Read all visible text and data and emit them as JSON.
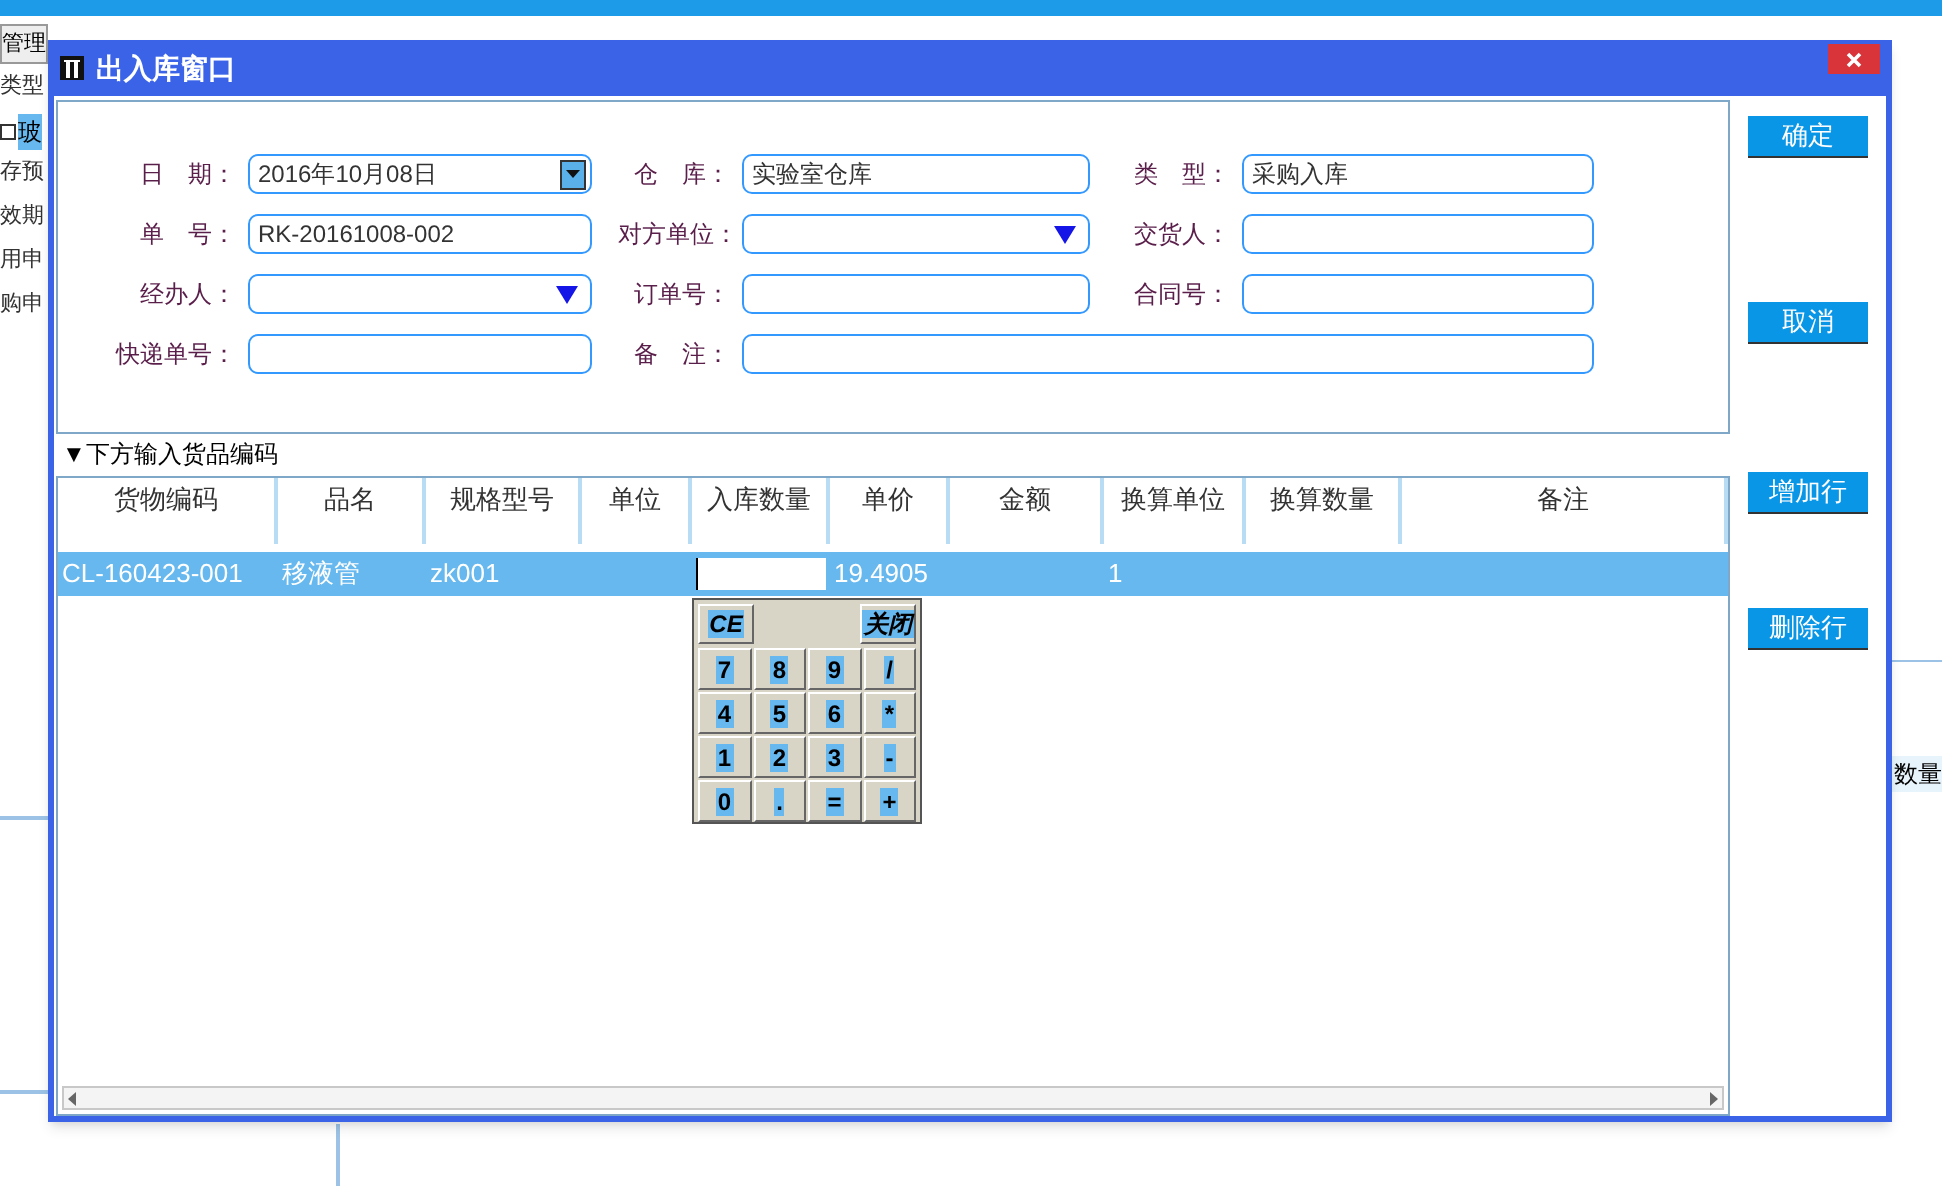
{
  "background": {
    "sidebar_items": [
      {
        "text": "管理",
        "kind": "button"
      },
      {
        "text": "类型",
        "kind": "text"
      },
      {
        "text": "玻",
        "kind": "checkbox",
        "checked": false,
        "selected": true
      },
      {
        "text": "存预",
        "kind": "text"
      },
      {
        "text": "效期",
        "kind": "text"
      },
      {
        "text": "用申",
        "kind": "text"
      },
      {
        "text": "购申",
        "kind": "text"
      }
    ],
    "column_label": "数量"
  },
  "dialog": {
    "title": "出入库窗口",
    "form": {
      "rows": [
        [
          {
            "label": "日　期：",
            "value": "2016年10月08日",
            "kind": "date"
          },
          {
            "label": "仓　库：",
            "value": "实验室仓库",
            "kind": "text"
          },
          {
            "label": "类　型：",
            "value": "采购入库",
            "kind": "text"
          }
        ],
        [
          {
            "label": "单　号：",
            "value": "RK-20161008-002",
            "kind": "text"
          },
          {
            "label": "对方单位：",
            "kind": "select"
          },
          {
            "label": "交货人：",
            "kind": "text"
          }
        ],
        [
          {
            "label": "经办人：",
            "kind": "select"
          },
          {
            "label": "订单号：",
            "kind": "text"
          },
          {
            "label": "合同号：",
            "kind": "text"
          }
        ],
        [
          {
            "label": "快递单号：",
            "kind": "text"
          },
          {
            "label": "备　注：",
            "kind": "text"
          }
        ]
      ]
    },
    "section_label": "▼下方输入货品编码",
    "table": {
      "columns": [
        "货物编码",
        "品名",
        "规格型号",
        "单位",
        "入库数量",
        "单价",
        "金额",
        "换算单位",
        "换算数量",
        "备注"
      ],
      "rows": [
        {
          "selected": true,
          "cells": [
            {
              "text": "CL-160423-001"
            },
            {
              "text": "移液管"
            },
            {
              "text": "zk001"
            },
            {},
            {
              "kind": "input"
            },
            {
              "text": "19.4905"
            },
            {},
            {
              "text": "1"
            },
            {},
            {}
          ]
        }
      ]
    },
    "keypad": {
      "top_keys": [
        "CE",
        "关闭"
      ],
      "keys": [
        "7",
        "8",
        "9",
        "/",
        "4",
        "5",
        "6",
        "*",
        "1",
        "2",
        "3",
        "-",
        "0",
        ".",
        "=",
        "+"
      ]
    },
    "buttons": [
      {
        "label": "确定"
      },
      {
        "label": "取消"
      },
      {
        "label": "增加行"
      },
      {
        "label": "删除行"
      }
    ]
  }
}
